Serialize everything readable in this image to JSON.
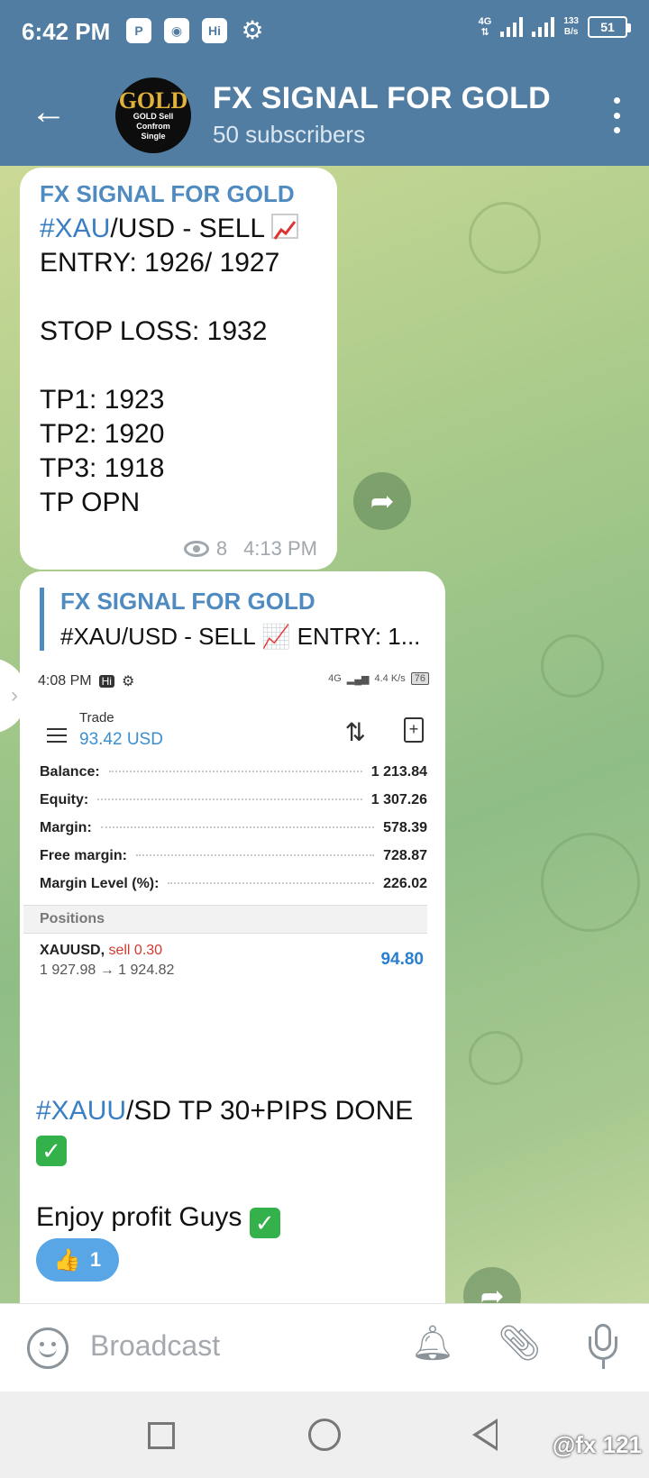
{
  "status_bar": {
    "time": "6:42 PM",
    "icons": [
      "p-app-icon",
      "game-icon",
      "hi-icon",
      "gear-icon"
    ],
    "network_label": "4G",
    "speed_value": "133",
    "speed_unit": "B/s",
    "battery": "51"
  },
  "header": {
    "avatar_big": "GOLD",
    "avatar_line1": "GOLD Sell",
    "avatar_line2": "Confrom",
    "avatar_line3": "Single",
    "title": "FX SIGNAL FOR GOLD",
    "subtitle": "50 subscribers"
  },
  "messages": [
    {
      "sender": "FX SIGNAL FOR GOLD",
      "hashtag": "#XAU",
      "line1_rest": "/USD - SELL",
      "body": "\nENTRY: 1926/ 1927\n\nSTOP LOSS: 1932\n\nTP1: 1923\nTP2: 1920\nTP3: 1918\nTP OPN",
      "views": "8",
      "time": "4:13 PM"
    },
    {
      "reply_sender": "FX SIGNAL FOR GOLD",
      "reply_text": "#XAU/USD - SELL 📈  ENTRY: 1...",
      "embedded": {
        "status_time": "4:08 PM",
        "status_net": "4G",
        "status_speed": "4.4 K/s",
        "status_battery": "76",
        "trade_label": "Trade",
        "trade_value": "93.42 USD",
        "rows": [
          {
            "label": "Balance:",
            "value": "1 213.84"
          },
          {
            "label": "Equity:",
            "value": "1 307.26"
          },
          {
            "label": "Margin:",
            "value": "578.39"
          },
          {
            "label": "Free margin:",
            "value": "728.87"
          },
          {
            "label": "Margin Level (%):",
            "value": "226.02"
          }
        ],
        "positions_header": "Positions",
        "position_symbol": "XAUUSD,",
        "position_side": "sell 0.30",
        "position_prices": "1 927.98 → 1 924.82",
        "position_profit": "94.80"
      },
      "hashtag": "#XAUU",
      "text_rest": "/SD TP 30+PIPS DONE",
      "text2": "Enjoy profit Guys",
      "reaction_count": "1"
    }
  ],
  "input": {
    "placeholder": "Broadcast"
  },
  "watermark": "@fx 121"
}
